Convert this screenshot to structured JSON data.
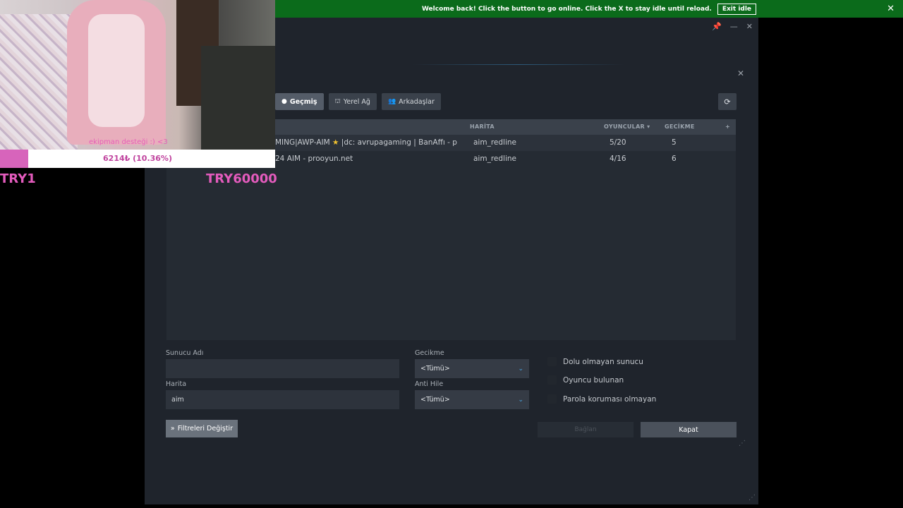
{
  "banner": {
    "message": "Welcome back! Click the button to go online. Click the X to stay idle until reload.",
    "button": "Exit idle",
    "close": "✕"
  },
  "window": {
    "pin": "📌",
    "minimize": "—",
    "close": "✕",
    "dialog_close": "✕"
  },
  "tabs": [
    {
      "label": "Geçmiş",
      "icon": "clock-icon",
      "glyph": "●"
    },
    {
      "label": "Yerel Ağ",
      "icon": "network-icon",
      "glyph": "⛫"
    },
    {
      "label": "Arkadaşlar",
      "icon": "friends-icon",
      "glyph": "👥"
    }
  ],
  "refresh_glyph": "⟳",
  "list": {
    "columns": {
      "map": "HARİTA",
      "players": "OYUNCULAR ▾",
      "latency": "GECİKME",
      "add": "+"
    },
    "rows": [
      {
        "name_pre": "MING|AWP-AIM ",
        "name_post": " |dc: avrupagaming | BanAffı - p",
        "map": "aim_redline",
        "players": "5/20",
        "latency": "5"
      },
      {
        "name_pre": "24 AIM - prooyun.net",
        "name_post": "",
        "map": "aim_redline",
        "players": "4/16",
        "latency": "6"
      }
    ]
  },
  "filters": {
    "server_name_label": "Sunucu Adı",
    "server_name_value": "",
    "map_label": "Harita",
    "map_value": "aim",
    "latency_label": "Gecikme",
    "latency_value": "<Tümü>",
    "anticheat_label": "Anti Hile",
    "anticheat_value": "<Tümü>",
    "checkboxes": [
      "Dolu olmayan sunucu",
      "Oyuncu bulunan",
      "Parola koruması olmayan"
    ],
    "change_filters": "Filtreleri Değiştir",
    "connect": "Bağlan",
    "close": "Kapat"
  },
  "overlay": {
    "caption": "ekipman desteği :) <3",
    "progress_text": "6214₺ (10.36%)",
    "progress_fraction": 0.1036,
    "min_label": "TRY1",
    "max_label": "TRY60000"
  }
}
